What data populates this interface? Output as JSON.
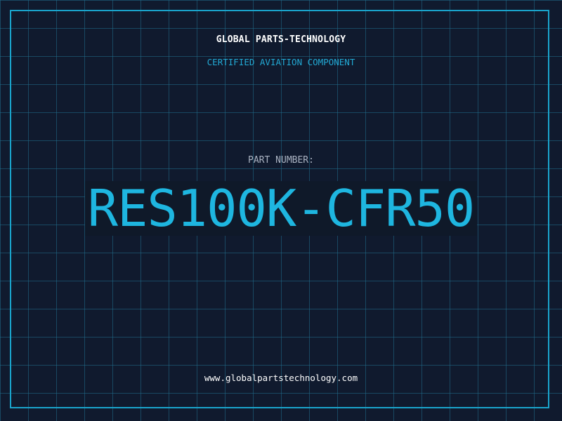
{
  "header": {
    "company": "GLOBAL PARTS-TECHNOLOGY",
    "subtitle": "CERTIFIED AVIATION COMPONENT"
  },
  "part": {
    "label": "PART NUMBER:",
    "number": "RES100K-CFR50"
  },
  "footer": {
    "website": "www.globalpartstechnology.com"
  },
  "colors": {
    "background": "#101a2e",
    "grid": "#216e8c",
    "accent": "#1eb6e0",
    "frame": "#1aa4cc",
    "label": "#aab3c2",
    "text": "#ffffff"
  }
}
